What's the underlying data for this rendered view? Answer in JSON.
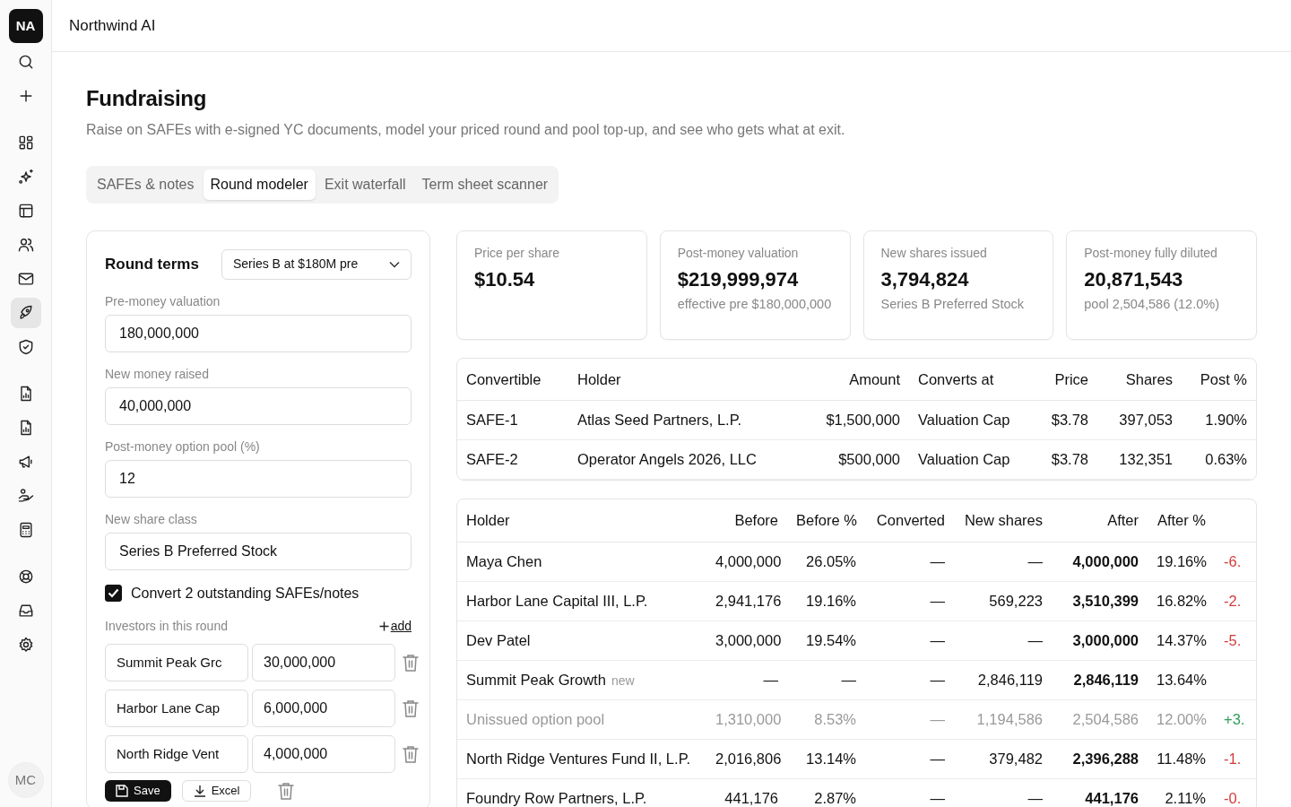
{
  "workspace": {
    "initials": "NA",
    "name": "Northwind AI"
  },
  "sidebar": {
    "items": [
      {
        "selected": false
      },
      {
        "selected": false
      },
      {
        "selected": false
      },
      {
        "selected": false
      },
      {
        "selected": false
      },
      {
        "selected": false
      },
      {
        "selected": false
      },
      {
        "selected": true
      },
      {
        "selected": false
      },
      {
        "selected": false
      },
      {
        "selected": false
      },
      {
        "selected": false
      },
      {
        "selected": false
      },
      {
        "selected": false
      },
      {
        "selected": false
      },
      {
        "selected": false
      },
      {
        "selected": false
      }
    ],
    "user_initials": "MC"
  },
  "page": {
    "title": "Fundraising",
    "subtitle": "Raise on SAFEs with e-signed YC documents, model your priced round and pool top-up, and see who gets what at exit.",
    "tabs": [
      {
        "label": "SAFEs & notes",
        "selected": false
      },
      {
        "label": "Round modeler",
        "selected": true
      },
      {
        "label": "Exit waterfall",
        "selected": false
      },
      {
        "label": "Term sheet scanner",
        "selected": false
      }
    ]
  },
  "round_terms": {
    "title": "Round terms",
    "preset": "Series B at $180M pre",
    "fields": [
      {
        "label": "Pre-money valuation",
        "value": "180,000,000"
      },
      {
        "label": "New money raised",
        "value": "40,000,000"
      },
      {
        "label": "Post-money option pool (%)",
        "value": "12"
      },
      {
        "label": "New share class",
        "value": "Series B Preferred Stock"
      }
    ],
    "convert": {
      "label": "Convert 2 outstanding SAFEs/notes",
      "checked": true
    },
    "investors_label": "Investors in this round",
    "add_label": "add",
    "investors": [
      {
        "name": "Summit Peak Grc",
        "amount": "30,000,000"
      },
      {
        "name": "Harbor Lane Cap",
        "amount": "6,000,000"
      },
      {
        "name": "North Ridge Vent",
        "amount": "4,000,000"
      }
    ],
    "buttons": [
      "Save",
      "Excel"
    ]
  },
  "metrics": [
    {
      "label": "Price per share",
      "value": "$10.54"
    },
    {
      "label": "Post-money valuation",
      "value": "$219,999,974",
      "note": "effective pre $180,000,000"
    },
    {
      "label": "New shares issued",
      "value": "3,794,824",
      "note": "Series B Preferred Stock"
    },
    {
      "label": "Post-money fully diluted",
      "value": "20,871,543",
      "note": "pool 2,504,586 (12.0%)"
    }
  ],
  "convertibles": {
    "columns": [
      "Convertible",
      "Holder",
      "Amount",
      "Converts at",
      "Price",
      "Shares",
      "Post %"
    ],
    "rows": [
      [
        "SAFE-1",
        "Atlas Seed Partners, L.P.",
        "$1,500,000",
        "Valuation Cap",
        "$3.78",
        "397,053",
        "1.90%"
      ],
      [
        "SAFE-2",
        "Operator Angels 2026, LLC",
        "$500,000",
        "Valuation Cap",
        "$3.78",
        "132,351",
        "0.63%"
      ]
    ]
  },
  "cap_table": {
    "columns": [
      "Holder",
      "Before",
      "Before %",
      "Converted",
      "New shares",
      "After",
      "After %"
    ],
    "rows": [
      {
        "cells": [
          "Maya Chen",
          "4,000,000",
          "26.05%",
          "—",
          "—",
          "4,000,000",
          "19.16%"
        ],
        "change": "-6.",
        "color": "#d43b3b",
        "muted": false
      },
      {
        "cells": [
          "Harbor Lane Capital III, L.P.",
          "2,941,176",
          "19.16%",
          "—",
          "569,223",
          "3,510,399",
          "16.82%"
        ],
        "change": "-2.",
        "color": "#d43b3b",
        "muted": false
      },
      {
        "cells": [
          "Dev Patel",
          "3,000,000",
          "19.54%",
          "—",
          "—",
          "3,000,000",
          "14.37%"
        ],
        "change": "-5.",
        "color": "#d43b3b",
        "muted": false
      },
      {
        "cells": [
          "Summit Peak Growth",
          "—",
          "—",
          "—",
          "2,846,119",
          "2,846,119",
          "13.64%"
        ],
        "tag": "new",
        "muted": false
      },
      {
        "cells": [
          "Unissued option pool",
          "1,310,000",
          "8.53%",
          "—",
          "1,194,586",
          "2,504,586",
          "12.00%"
        ],
        "change": "+3.",
        "color": "#2f9d5a",
        "muted": true
      },
      {
        "cells": [
          "North Ridge Ventures Fund II, L.P.",
          "2,016,806",
          "13.14%",
          "—",
          "379,482",
          "2,396,288",
          "11.48%"
        ],
        "change": "-1.",
        "color": "#d43b3b",
        "muted": false
      },
      {
        "cells": [
          "Foundry Row Partners, L.P.",
          "441,176",
          "2.87%",
          "—",
          "—",
          "441,176",
          "2.11%"
        ],
        "change": "-0.",
        "color": "#d43b3b",
        "muted": false
      }
    ]
  }
}
